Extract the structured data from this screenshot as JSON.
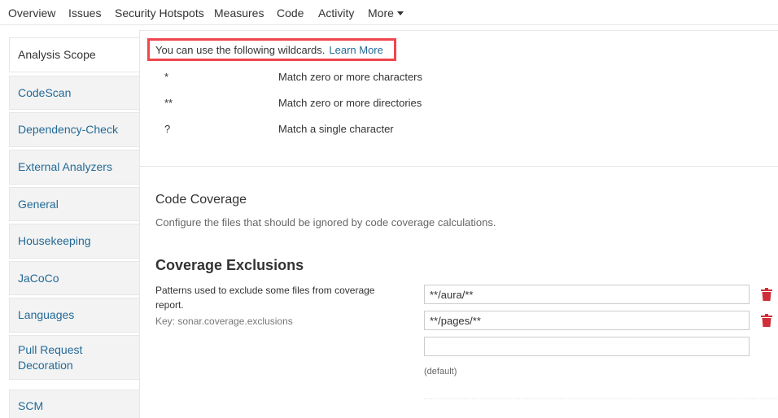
{
  "nav": {
    "items": [
      {
        "label": "Overview"
      },
      {
        "label": "Issues"
      },
      {
        "label": "Security Hotspots"
      },
      {
        "label": "Measures"
      },
      {
        "label": "Code"
      },
      {
        "label": "Activity"
      },
      {
        "label": "More"
      }
    ]
  },
  "sidebar": {
    "items": [
      {
        "label": "Analysis Scope",
        "active": true
      },
      {
        "label": "CodeScan"
      },
      {
        "label": "Dependency-Check"
      },
      {
        "label": "External Analyzers"
      },
      {
        "label": "General"
      },
      {
        "label": "Housekeeping"
      },
      {
        "label": "JaCoCo"
      },
      {
        "label": "Languages"
      },
      {
        "label": "Pull Request Decoration"
      },
      {
        "label": "SCM"
      }
    ]
  },
  "wildcards": {
    "intro": "You can use the following wildcards.",
    "learn_more": "Learn More",
    "rows": [
      {
        "symbol": "*",
        "description": "Match zero or more characters"
      },
      {
        "symbol": "**",
        "description": "Match zero or more directories"
      },
      {
        "symbol": "?",
        "description": "Match a single character"
      }
    ]
  },
  "code_coverage": {
    "title": "Code Coverage",
    "description": "Configure the files that should be ignored by code coverage calculations."
  },
  "coverage_exclusions": {
    "title": "Coverage Exclusions",
    "description": "Patterns used to exclude some files from coverage report.",
    "key": "Key: sonar.coverage.exclusions",
    "values": [
      "**/aura/**",
      "**/pages/**",
      ""
    ],
    "default_label": "(default)"
  },
  "colors": {
    "link": "#236a97",
    "highlight_border": "#f0464d",
    "delete_icon": "#d02f3a"
  }
}
